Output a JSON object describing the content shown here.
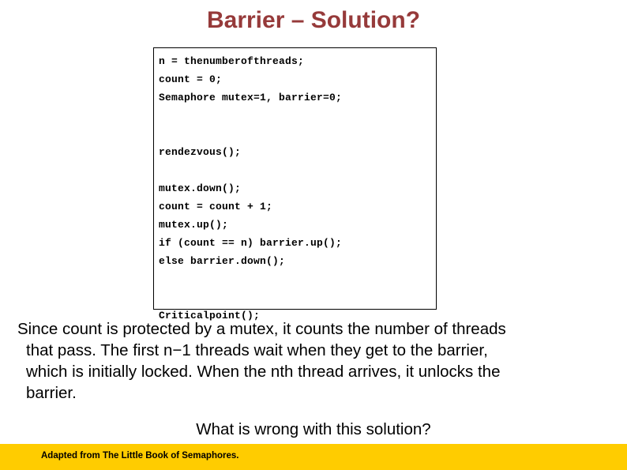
{
  "slide": {
    "title": "Barrier – Solution?",
    "title_color": "#963a3a",
    "background_color": "#ffffff"
  },
  "code_block": {
    "border_color": "#000000",
    "lines": [
      "n = thenumberofthreads;",
      "count = 0;",
      "Semaphore mutex=1, barrier=0;",
      "",
      "",
      "rendezvous();",
      "",
      "mutex.down();",
      "count = count + 1;",
      "mutex.up();",
      "if (count == n) barrier.up();",
      "else barrier.down();",
      "",
      "",
      "Criticalpoint();"
    ]
  },
  "body": {
    "line1": "Since count is protected by a mutex, it counts the number of threads",
    "line2": "that pass. The first n−1 threads wait when they get to the barrier,",
    "line3": "which is initially locked. When the nth thread arrives, it unlocks the",
    "line4": "barrier."
  },
  "question": {
    "text": "What is wrong with this solution?"
  },
  "footer": {
    "text": "Adapted from The Little Book of Semaphores.",
    "band_color": "#ffcc00",
    "text_color": "#000000"
  }
}
